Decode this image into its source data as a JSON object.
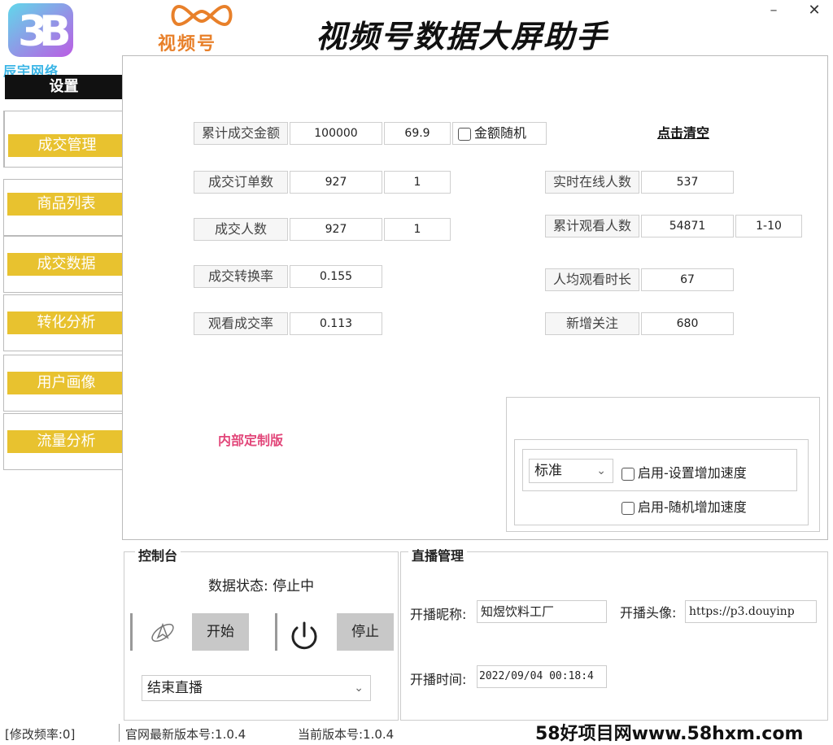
{
  "header": {
    "brand_text": "辰宇网络",
    "app_logo_text": "视频号",
    "title": "视频号数据大屏助手",
    "minimize": "–",
    "close": "✕"
  },
  "sidebar": {
    "settings_label": "设置",
    "items": [
      {
        "label": "成交管理"
      },
      {
        "label": "商品列表"
      },
      {
        "label": "成交数据"
      },
      {
        "label": "转化分析"
      },
      {
        "label": "用户画像"
      },
      {
        "label": "流量分析"
      }
    ]
  },
  "main": {
    "total_amount": {
      "label": "累计成交金额",
      "value": "100000",
      "value2": "69.9"
    },
    "random_amount": "金额随机",
    "clear": "点击清空",
    "orders": {
      "label": "成交订单数",
      "value": "927",
      "value2": "1"
    },
    "buyers": {
      "label": "成交人数",
      "value": "927",
      "value2": "1"
    },
    "conversion": {
      "label": "成交转换率",
      "value": "0.155"
    },
    "watch_conversion": {
      "label": "观看成交率",
      "value": "0.113"
    },
    "online": {
      "label": "实时在线人数",
      "value": "537"
    },
    "total_viewers": {
      "label": "累计观看人数",
      "value": "54871",
      "value2": "1-10"
    },
    "avg_watch": {
      "label": "人均观看时长",
      "value": "67"
    },
    "new_followers": {
      "label": "新增关注",
      "value": "680"
    },
    "custom_version": "内部定制版",
    "speed_mode": "标准",
    "speed_set": "启用-设置增加速度",
    "speed_random": "启用-随机增加速度"
  },
  "console": {
    "title": "控制台",
    "status_label": "数据状态:",
    "status_value": "停止中",
    "start": "开始",
    "stop": "停止",
    "end_option": "结束直播"
  },
  "live": {
    "title": "直播管理",
    "nick_label": "开播昵称:",
    "nick_value": "知煜饮料工厂",
    "avatar_label": "开播头像:",
    "avatar_value": "https://p3.douyinp",
    "time_label": "开播时间:",
    "time_value": "2022/09/04 00:18:4"
  },
  "footer": {
    "freq": "[修改频率:0]",
    "latest_version": "官网最新版本号:1.0.4",
    "current_version": "当前版本号:1.0.4",
    "watermark": "58好项目网www.58hxm.com"
  },
  "colors": {
    "sidebar_button": "#e8c22f",
    "custom_version": "#e2477a",
    "logo_orange": "#e8802a",
    "brand_blue": "#3ab5e6"
  }
}
